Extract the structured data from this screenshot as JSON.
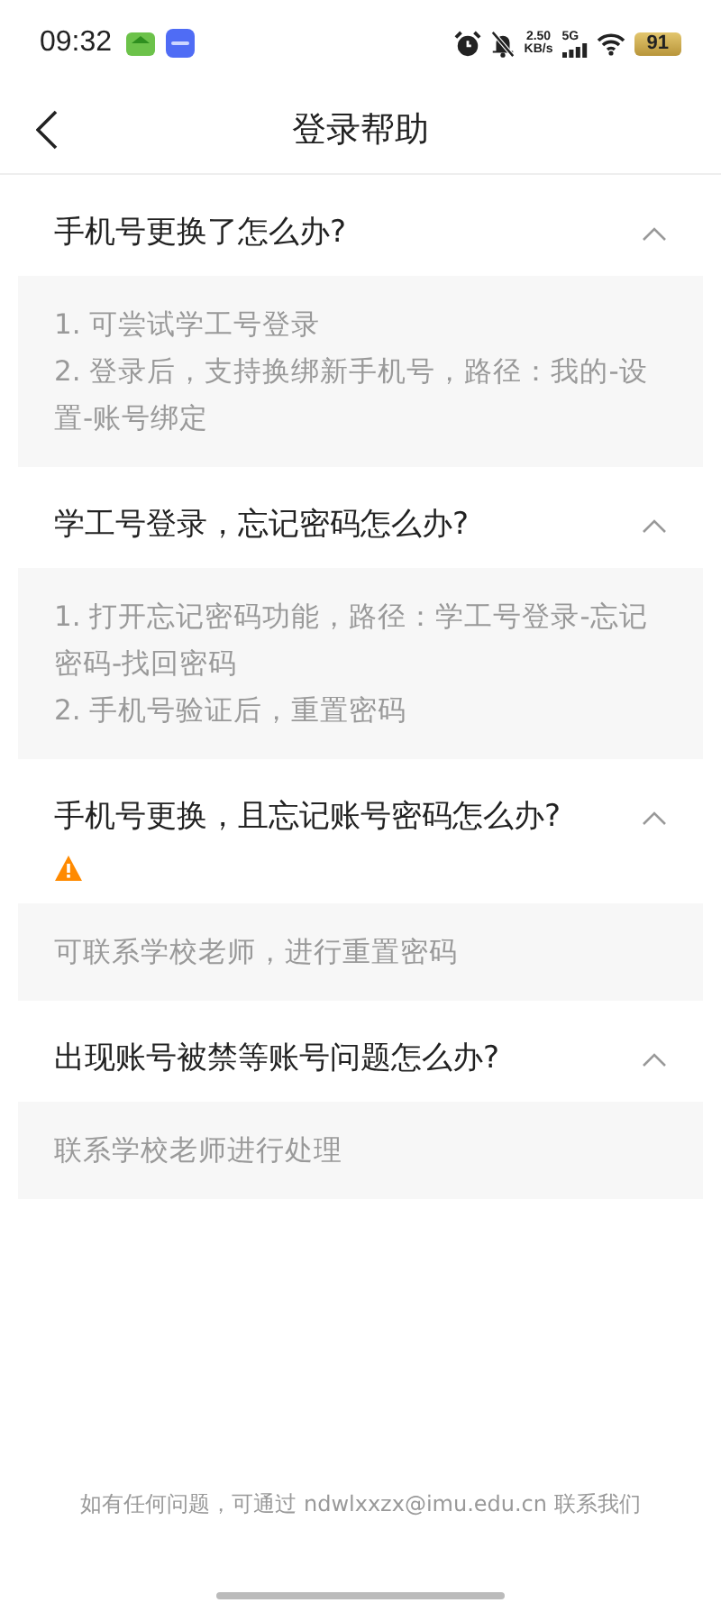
{
  "status_bar": {
    "time": "09:32",
    "net_speed": "2.50",
    "net_unit": "KB/s",
    "network": "5G",
    "battery": "91"
  },
  "header": {
    "title": "登录帮助"
  },
  "faqs": [
    {
      "question": "手机号更换了怎么办?",
      "expanded": true,
      "warning": false,
      "answer": [
        "1. 可尝试学工号登录",
        "2. 登录后，支持换绑新手机号，路径：我的-设置-账号绑定"
      ]
    },
    {
      "question": "学工号登录，忘记密码怎么办?",
      "expanded": true,
      "warning": false,
      "answer": [
        "1. 打开忘记密码功能，路径：学工号登录-忘记密码-找回密码",
        "2. 手机号验证后，重置密码"
      ]
    },
    {
      "question": "手机号更换，且忘记账号密码怎么办?",
      "expanded": true,
      "warning": true,
      "answer": [
        "可联系学校老师，进行重置密码"
      ]
    },
    {
      "question": "出现账号被禁等账号问题怎么办?",
      "expanded": true,
      "warning": false,
      "answer": [
        "联系学校老师进行处理"
      ]
    }
  ],
  "footer": {
    "text": "如有任何问题，可通过 ndwlxxzx@imu.edu.cn 联系我们"
  }
}
